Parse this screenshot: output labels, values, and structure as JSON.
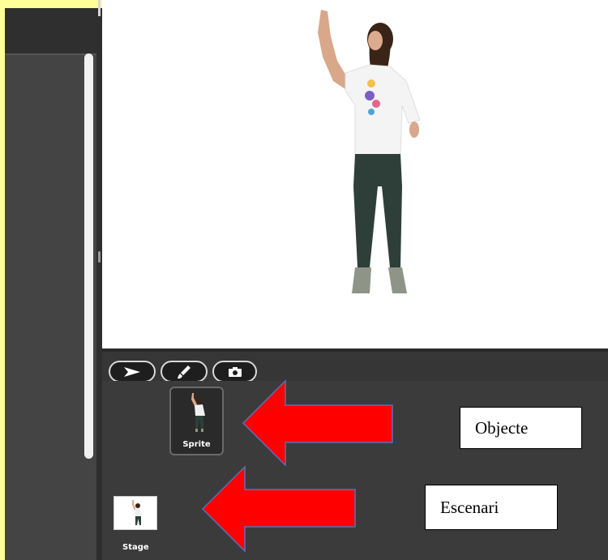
{
  "toolbar": {
    "select_tool": "arrow-pointer-icon",
    "paint_tool": "paintbrush-icon",
    "camera_tool": "camera-icon"
  },
  "sprites": [
    {
      "label": "Sprite"
    }
  ],
  "stage_item": {
    "label": "Stage"
  },
  "annotations": {
    "objecte": "Objecte",
    "escenari": "Escenari",
    "arrow_color": "#ff0000",
    "arrow_outline": "#5b6fb5"
  },
  "colors": {
    "page_border": "#ffff99",
    "panel_dark": "#3b3b3b",
    "stage_bg": "#ffffff"
  }
}
